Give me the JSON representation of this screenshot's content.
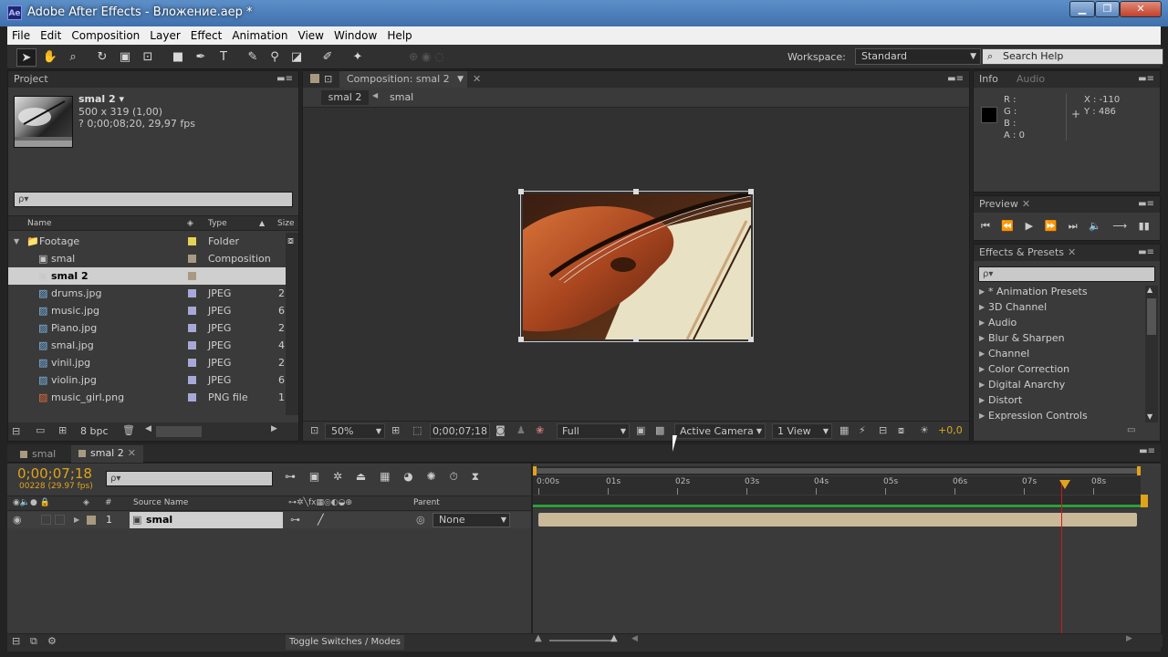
{
  "window": {
    "title": "Adobe After Effects - Вложение.aep *",
    "app_icon": "Ae"
  },
  "menu": [
    "File",
    "Edit",
    "Composition",
    "Layer",
    "Effect",
    "Animation",
    "View",
    "Window",
    "Help"
  ],
  "toolbar": {
    "workspace_label": "Workspace:",
    "workspace_value": "Standard",
    "search_placeholder": "Search Help"
  },
  "project": {
    "tab": "Project",
    "item_name": "smal 2 ▾",
    "item_dims": "500 x 319 (1,00)",
    "item_duration": "? 0;00;08;20, 29,97 fps",
    "search_placeholder": "ρ▾",
    "columns": [
      "Name",
      "Type",
      "Size"
    ],
    "rows": [
      {
        "name": "Footage",
        "type": "Folder",
        "size": "",
        "color": "#e6d254",
        "kind": "folder"
      },
      {
        "name": "smal",
        "type": "Composition",
        "size": "",
        "color": "#a89a80",
        "kind": "comp"
      },
      {
        "name": "smal 2",
        "type": "Composition",
        "size": "",
        "color": "#a89a80",
        "kind": "comp",
        "selected": true
      },
      {
        "name": "drums.jpg",
        "type": "JPEG",
        "size": "2",
        "color": "#a8a8d8",
        "kind": "img"
      },
      {
        "name": "music.jpg",
        "type": "JPEG",
        "size": "6",
        "color": "#a8a8d8",
        "kind": "img"
      },
      {
        "name": "Piano.jpg",
        "type": "JPEG",
        "size": "2",
        "color": "#a8a8d8",
        "kind": "img"
      },
      {
        "name": "smal.jpg",
        "type": "JPEG",
        "size": "4",
        "color": "#a8a8d8",
        "kind": "img"
      },
      {
        "name": "vinil.jpg",
        "type": "JPEG",
        "size": "2",
        "color": "#a8a8d8",
        "kind": "img"
      },
      {
        "name": "violin.jpg",
        "type": "JPEG",
        "size": "6",
        "color": "#a8a8d8",
        "kind": "img"
      },
      {
        "name": "music_girl.png",
        "type": "PNG file",
        "size": "1",
        "color": "#a8a8d8",
        "kind": "png"
      }
    ],
    "bpc": "8 bpc"
  },
  "composition": {
    "tab": "Composition: smal 2",
    "breadcrumbs": [
      "smal 2",
      "smal"
    ],
    "zoom": "50%",
    "timecode": "0;00;07;18",
    "resolution": "Full",
    "camera": "Active Camera",
    "views": "1 View",
    "exposure": "+0,0"
  },
  "info": {
    "tab_info": "Info",
    "tab_audio": "Audio",
    "r": "R :",
    "g": "G :",
    "b": "B :",
    "a": "A : 0",
    "x": "X : -110",
    "y": "Y : 486"
  },
  "preview": {
    "tab": "Preview"
  },
  "effects": {
    "tab": "Effects & Presets",
    "search_placeholder": "ρ▾",
    "items": [
      "* Animation Presets",
      "3D Channel",
      "Audio",
      "Blur & Sharpen",
      "Channel",
      "Color Correction",
      "Digital Anarchy",
      "Distort",
      "Expression Controls"
    ]
  },
  "timeline": {
    "tabs": [
      "smal",
      "smal 2"
    ],
    "timecode": "0;00;07;18",
    "frame_info": "00228 (29.97 fps)",
    "search_placeholder": "ρ▾",
    "col_hash": "#",
    "col_source": "Source Name",
    "col_parent": "Parent",
    "layer_num": "1",
    "layer_name": "smal",
    "parent_value": "None",
    "ruler": [
      "0:00s",
      "01s",
      "02s",
      "03s",
      "04s",
      "05s",
      "06s",
      "07s",
      "08s"
    ],
    "toggle_label": "Toggle Switches / Modes"
  }
}
